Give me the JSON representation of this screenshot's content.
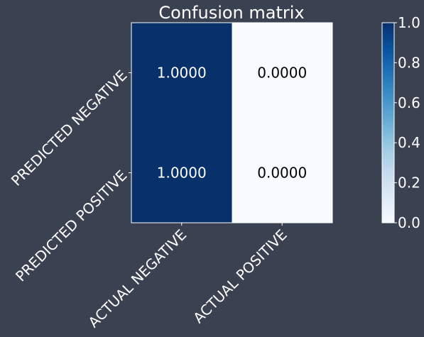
{
  "chart_data": {
    "type": "heatmap",
    "title": "Confusion matrix",
    "row_labels": [
      "PREDICTED NEGATIVE",
      "PREDICTED POSITIVE"
    ],
    "col_labels": [
      "ACTUAL NEGATIVE",
      "ACTUAL POSITIVE"
    ],
    "values": [
      [
        1.0,
        0.0
      ],
      [
        1.0,
        0.0
      ]
    ],
    "cell_labels": [
      [
        "1.0000",
        "0.0000"
      ],
      [
        "1.0000",
        "0.0000"
      ]
    ],
    "colorbar": {
      "range": [
        0.0,
        1.0
      ],
      "ticks": [
        "0.0",
        "0.2",
        "0.4",
        "0.6",
        "0.8",
        "1.0"
      ],
      "colormap": "Blues",
      "low_color": "#f7fbff",
      "high_color": "#08306b"
    },
    "grid": false
  },
  "colors": {
    "background": "#3a4150",
    "text_light": "#ffffff",
    "text_dark": "#000000"
  }
}
